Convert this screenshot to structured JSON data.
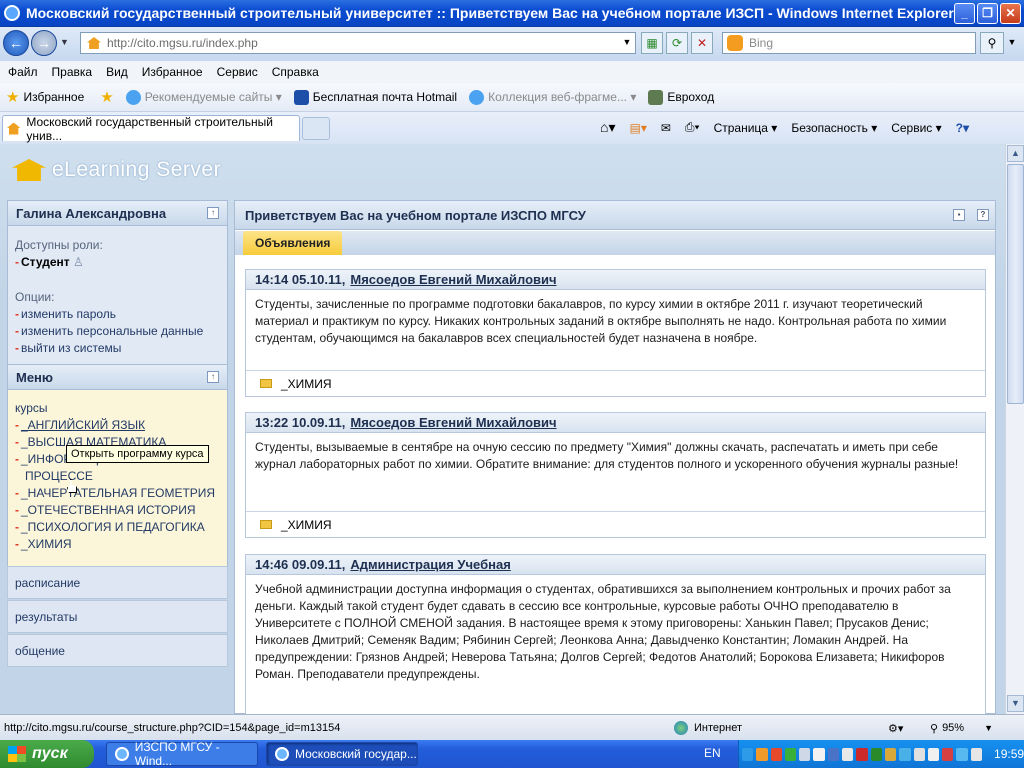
{
  "window": {
    "title": "Московский государственный строительный университет :: Приветствуем Вас на учебном портале ИЗСП - Windows Internet Explorer"
  },
  "address": {
    "url": "http://cito.mgsu.ru/index.php",
    "search_placeholder": "Bing"
  },
  "menu": [
    "Файл",
    "Правка",
    "Вид",
    "Избранное",
    "Сервис",
    "Справка"
  ],
  "favorites": {
    "label": "Избранное",
    "items": [
      "Рекомендуемые сайты ▾",
      "Бесплатная почта Hotmail",
      "Коллекция веб-фрагме... ▾",
      "Евроход"
    ]
  },
  "tab": {
    "title": "Московский государственный строительный унив..."
  },
  "commands": [
    "Страница ▾",
    "Безопасность ▾",
    "Сервис ▾"
  ],
  "logo": "eLearning Server",
  "user": {
    "name": "Галина  Александровна",
    "roles_label": "Доступны роли:",
    "role": "Студент",
    "options_label": "Опции:",
    "options": [
      "изменить пароль",
      "изменить персональные данные",
      "выйти из системы"
    ]
  },
  "menu_panel": {
    "title": "Меню",
    "courses_label": "курсы",
    "courses": [
      "_АНГЛИЙСКИЙ ЯЗЫК",
      "_ВЫСШАЯ МАТЕМАТИКА",
      "_ИНФОРМАЦИЯ ОБ УЧЕБНОМ",
      "_НАЧЕРТАТЕЛЬНАЯ ГЕОМЕТРИЯ",
      "_ОТЕЧЕСТВЕННАЯ ИСТОРИЯ",
      "_ПСИХОЛОГИЯ И ПЕДАГОГИКА",
      "_ХИМИЯ"
    ],
    "course_cont": "ПРОЦЕССЕ",
    "tooltip": "Открыть программу курса",
    "sections": [
      "расписание",
      "результаты",
      "общение"
    ]
  },
  "main": {
    "title": "Приветствуем Вас на учебном портале ИЗСПО МГСУ",
    "tab": "Объявления",
    "announcements": [
      {
        "time": "14:14 05.10.11,",
        "author": "Мясоедов Евгений Михайлович",
        "text": "Студенты, зачисленные по программе подготовки бакалавров, по курсу химии в октябре 2011 г. изучают теоретический материал и практикум по курсу. Никаких контрольных заданий в октябре выполнять не надо. Контрольная работа по химии студентам, обучающимся на бакалавров всех специальностей будет назначена в ноябре.",
        "course": "_ХИМИЯ"
      },
      {
        "time": "13:22 10.09.11,",
        "author": "Мясоедов Евгений Михайлович",
        "text": "Студенты, вызываемые в сентябре на очную сессию по предмету \"Химия\" должны скачать, распечатать и иметь при себе журнал лабораторных работ по химии. Обратите внимание: для студентов полного и ускоренного обучения журналы разные!",
        "course": "_ХИМИЯ"
      },
      {
        "time": "14:46 09.09.11,",
        "author": "Администрация Учебная",
        "text": "Учебной администрации доступна информация о студентах, обратившихся за выполнением контрольных и прочих работ за деньги. Каждый такой студент будет сдавать в сессию все контрольные, курсовые работы ОЧНО преподавателю в Университете с ПОЛНОЙ СМЕНОЙ задания. В настоящее время к этому приговорены: Ханькин Павел; Прусаков Денис; Николаев Дмитрий; Семеняк Вадим; Рябинин Сергей; Леонкова Анна; Давыдченко Константин; Ломакин Андрей. На предупреждении: Грязнов Андрей; Неверова Татьяна; Долгов Сергей; Федотов Анатолий; Борокова Елизавета; Никифоров Роман. Преподаватели предупреждены.",
        "course": ""
      }
    ]
  },
  "status": {
    "url": "http://cito.mgsu.ru/course_structure.php?CID=154&page_id=m13154",
    "zone": "Интернет",
    "zoom": "95%"
  },
  "taskbar": {
    "start": "пуск",
    "tasks": [
      "ИЗСПО МГСУ - Wind...",
      "Московский государ..."
    ],
    "lang": "EN",
    "clock": "19:59"
  }
}
